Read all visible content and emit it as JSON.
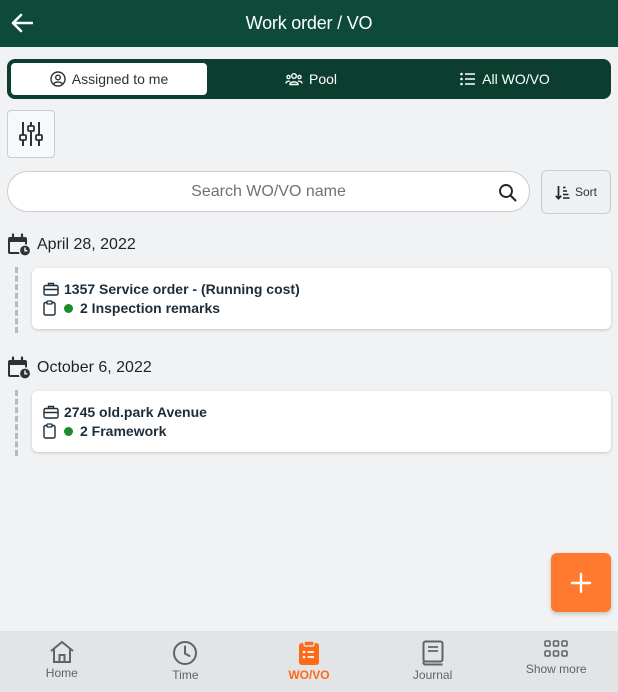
{
  "header": {
    "title": "Work order / VO"
  },
  "tabs": [
    {
      "label": "Assigned to me"
    },
    {
      "label": "Pool"
    },
    {
      "label": "All WO/VO"
    }
  ],
  "search": {
    "placeholder": "Search WO/VO name",
    "value": ""
  },
  "sort": {
    "label": "Sort"
  },
  "groups": [
    {
      "date": "April 28, 2022",
      "cards": [
        {
          "title": "1357 Service order - (Running cost)",
          "subtitle": "2 Inspection remarks"
        }
      ]
    },
    {
      "date": "October 6, 2022",
      "cards": [
        {
          "title": "2745 old.park Avenue",
          "subtitle": "2 Framework"
        }
      ]
    }
  ],
  "nav": [
    {
      "label": "Home",
      "icon": "home-icon"
    },
    {
      "label": "Time",
      "icon": "clock-icon"
    },
    {
      "label": "WO/VO",
      "icon": "clipboard-icon"
    },
    {
      "label": "Journal",
      "icon": "book-icon"
    },
    {
      "label": "Show more",
      "icon": "grid-icon"
    }
  ],
  "colors": {
    "header": "#0e4a3a",
    "accent": "#ff7a2f",
    "status_dot": "#1e8a2e"
  }
}
